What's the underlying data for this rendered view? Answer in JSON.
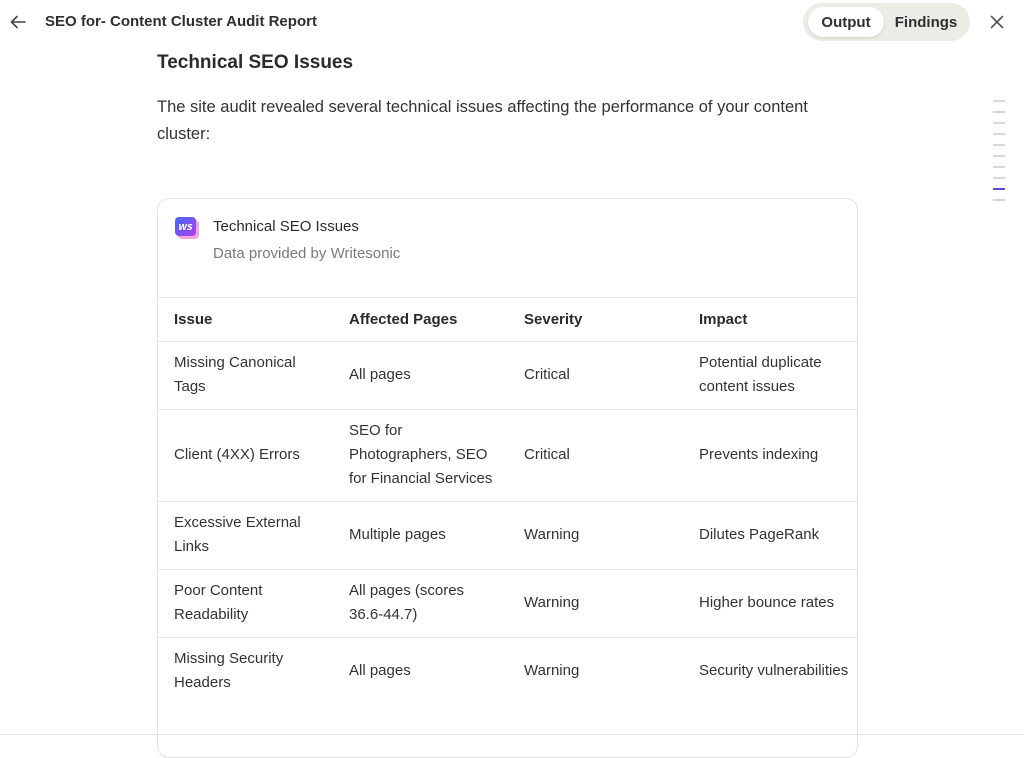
{
  "header": {
    "title": "SEO for- Content Cluster Audit Report",
    "tabs": [
      {
        "label": "Output",
        "active": true
      },
      {
        "label": "Findings",
        "active": false
      }
    ],
    "icons": {
      "back": "arrow-left-icon",
      "close": "close-icon"
    }
  },
  "section": {
    "heading": "Technical SEO Issues",
    "intro": "The site audit revealed several technical issues affecting the performance of your content cluster:"
  },
  "card": {
    "logo_text": "WS",
    "title": "Technical SEO Issues",
    "subtitle": "Data provided by Writesonic",
    "columns": [
      "Issue",
      "Affected Pages",
      "Severity",
      "Impact"
    ],
    "rows": [
      {
        "issue": "Missing Canonical Tags",
        "pages": "All pages",
        "severity": "Critical",
        "impact": "Potential duplicate content issues"
      },
      {
        "issue": "Client (4XX) Errors",
        "pages": "SEO for Photographers, SEO for Financial Services",
        "severity": "Critical",
        "impact": "Prevents indexing"
      },
      {
        "issue": "Excessive External Links",
        "pages": "Multiple pages",
        "severity": "Warning",
        "impact": "Dilutes PageRank"
      },
      {
        "issue": "Poor Content Readability",
        "pages": "All pages (scores 36.6-44.7)",
        "severity": "Warning",
        "impact": "Higher bounce rates"
      },
      {
        "issue": "Missing Security Headers",
        "pages": "All pages",
        "severity": "Warning",
        "impact": "Security vulnerabilities"
      }
    ]
  },
  "toc": {
    "count": 10,
    "active_index": 8
  },
  "colors": {
    "accent": "#5b4fc8",
    "logo_gradient_start": "#3f6cf6",
    "logo_gradient_end": "#b03cf2"
  }
}
